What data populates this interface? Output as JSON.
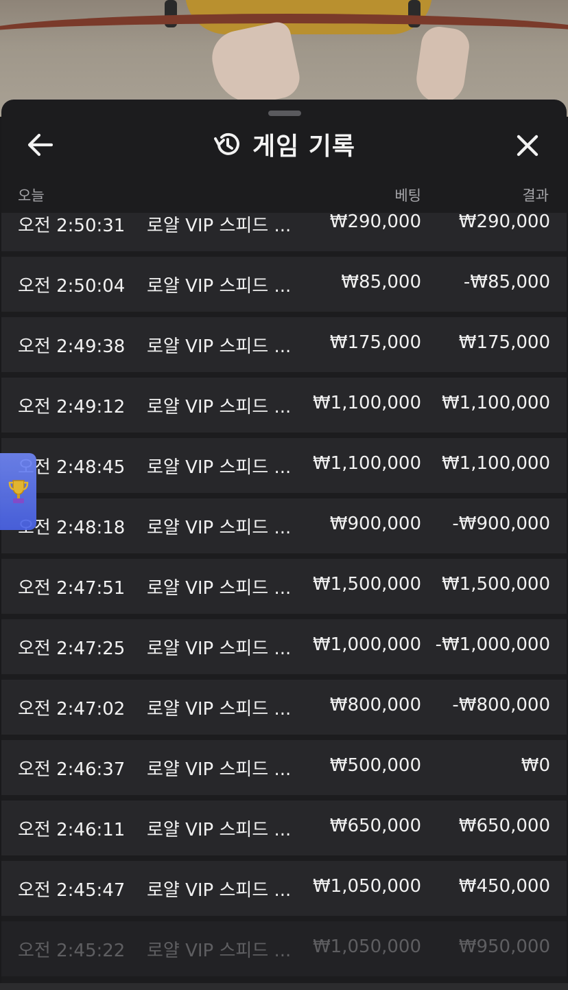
{
  "header": {
    "title": "게임 기록",
    "back_icon": "arrow-left-icon",
    "history_icon": "history-icon",
    "close_icon": "close-icon"
  },
  "columns": {
    "date": "오늘",
    "bet": "베팅",
    "result": "결과"
  },
  "rows": [
    {
      "time": "오전 2:50:31",
      "game": "로얄 VIP 스피드 ...",
      "bet": "₩290,000",
      "result": "₩290,000"
    },
    {
      "time": "오전 2:50:04",
      "game": "로얄 VIP 스피드 ...",
      "bet": "₩85,000",
      "result": "-₩85,000"
    },
    {
      "time": "오전 2:49:38",
      "game": "로얄 VIP 스피드 ...",
      "bet": "₩175,000",
      "result": "₩175,000"
    },
    {
      "time": "오전 2:49:12",
      "game": "로얄 VIP 스피드 ...",
      "bet": "₩1,100,000",
      "result": "₩1,100,000"
    },
    {
      "time": "오전 2:48:45",
      "game": "로얄 VIP 스피드 ...",
      "bet": "₩1,100,000",
      "result": "₩1,100,000"
    },
    {
      "time": "오전 2:48:18",
      "game": "로얄 VIP 스피드 ...",
      "bet": "₩900,000",
      "result": "-₩900,000"
    },
    {
      "time": "오전 2:47:51",
      "game": "로얄 VIP 스피드 ...",
      "bet": "₩1,500,000",
      "result": "₩1,500,000"
    },
    {
      "time": "오전 2:47:25",
      "game": "로얄 VIP 스피드 ...",
      "bet": "₩1,000,000",
      "result": "-₩1,000,000"
    },
    {
      "time": "오전 2:47:02",
      "game": "로얄 VIP 스피드 ...",
      "bet": "₩800,000",
      "result": "-₩800,000"
    },
    {
      "time": "오전 2:46:37",
      "game": "로얄 VIP 스피드 ...",
      "bet": "₩500,000",
      "result": "₩0"
    },
    {
      "time": "오전 2:46:11",
      "game": "로얄 VIP 스피드 ...",
      "bet": "₩650,000",
      "result": "₩650,000"
    },
    {
      "time": "오전 2:45:47",
      "game": "로얄 VIP 스피드 ...",
      "bet": "₩1,050,000",
      "result": "₩450,000"
    },
    {
      "time": "오전 2:45:22",
      "game": "로얄 VIP 스피드 ...",
      "bet": "₩1,050,000",
      "result": "₩950,000"
    }
  ],
  "widgets": {
    "trophy_icon": "trophy-icon"
  },
  "colors": {
    "sheet_bg": "#1c1c1e",
    "row_bg": "#27272a",
    "text": "#f2f2f2",
    "muted": "#a6a6aa"
  }
}
